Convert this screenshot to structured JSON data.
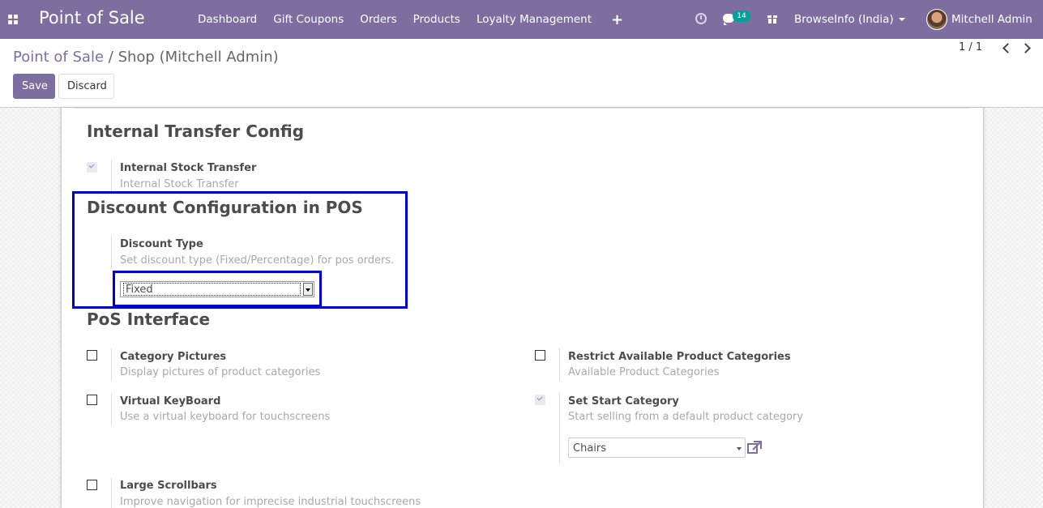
{
  "navbar": {
    "brand": "Point of Sale",
    "menu": [
      "Dashboard",
      "Gift Coupons",
      "Orders",
      "Products",
      "Loyalty Management"
    ],
    "chat_count": "14",
    "company": "BrowseInfo (India)",
    "user": "Mitchell Admin",
    "color": "#7c6f9f"
  },
  "breadcrumb": {
    "root": "Point of Sale",
    "separator": "/",
    "current": "Shop (Mitchell Admin)"
  },
  "buttons": {
    "save": "Save",
    "discard": "Discard"
  },
  "pager": {
    "value": "1 / 1"
  },
  "sections": {
    "internal_transfer": {
      "title": "Internal Transfer Config",
      "settings": [
        {
          "label": "Internal Stock Transfer",
          "help": "Internal Stock Transfer",
          "checked": true
        }
      ]
    },
    "discount": {
      "title": "Discount Configuration in POS",
      "label": "Discount Type",
      "help": "Set discount type (Fixed/Percentage) for pos orders.",
      "selected": "Fixed"
    },
    "pos_interface": {
      "title": "PoS Interface",
      "category_pictures": {
        "label": "Category Pictures",
        "help": "Display pictures of product categories",
        "checked": false
      },
      "restrict_categories": {
        "label": "Restrict Available Product Categories",
        "help": "Available Product Categories",
        "checked": false
      },
      "virtual_keyboard": {
        "label": "Virtual KeyBoard",
        "help": "Use a virtual keyboard for touchscreens",
        "checked": false
      },
      "start_category": {
        "label": "Set Start Category",
        "help": "Start selling from a default product category",
        "checked": true,
        "selected": "Chairs"
      },
      "large_scrollbars": {
        "label": "Large Scrollbars",
        "help": "Improve navigation for imprecise industrial touchscreens",
        "checked": false
      }
    }
  },
  "highlight_color": "#0000cc"
}
